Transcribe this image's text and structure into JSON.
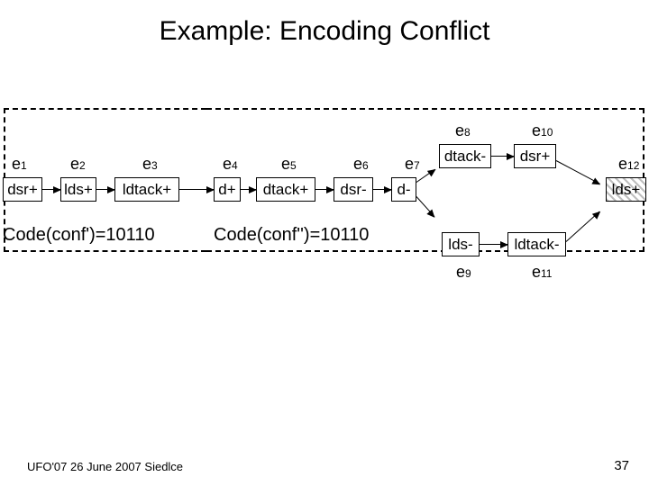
{
  "title": "Example: Encoding Conflict",
  "events": {
    "e1": "e",
    "e2": "e",
    "e3": "e",
    "e4": "e",
    "e5": "e",
    "e6": "e",
    "e7": "e",
    "e8": "e",
    "e9": "e",
    "e10": "e",
    "e11": "e",
    "e12": "e",
    "s1": "1",
    "s2": "2",
    "s3": "3",
    "s4": "4",
    "s5": "5",
    "s6": "6",
    "s7": "7",
    "s8": "8",
    "s9": "9",
    "s10": "10",
    "s11": "11",
    "s12": "12"
  },
  "chart_data": {
    "type": "diagram",
    "nodes": [
      {
        "id": "n1",
        "label": "dsr+",
        "event": "e1"
      },
      {
        "id": "n2",
        "label": "lds+",
        "event": "e2"
      },
      {
        "id": "n3",
        "label": "ldtack+",
        "event": "e3"
      },
      {
        "id": "n4",
        "label": "d+",
        "event": "e4"
      },
      {
        "id": "n5",
        "label": "dtack+",
        "event": "e5"
      },
      {
        "id": "n6",
        "label": "dsr-",
        "event": "e6"
      },
      {
        "id": "n7",
        "label": "d-",
        "event": "e7"
      },
      {
        "id": "n8",
        "label": "dtack-",
        "event": "e8"
      },
      {
        "id": "n9",
        "label": "lds-",
        "event": "e9"
      },
      {
        "id": "n10",
        "label": "dsr+",
        "event": "e10"
      },
      {
        "id": "n11",
        "label": "ldtack-",
        "event": "e11"
      },
      {
        "id": "n12",
        "label": "lds+",
        "event": "e12",
        "highlight": true
      }
    ],
    "edges": [
      [
        "n1",
        "n2"
      ],
      [
        "n2",
        "n3"
      ],
      [
        "n3",
        "n4"
      ],
      [
        "n4",
        "n5"
      ],
      [
        "n5",
        "n6"
      ],
      [
        "n6",
        "n7"
      ],
      [
        "n7",
        "n8"
      ],
      [
        "n8",
        "n10"
      ],
      [
        "n10",
        "n12"
      ],
      [
        "n7",
        "n9"
      ],
      [
        "n9",
        "n11"
      ],
      [
        "n11",
        "n12"
      ],
      [
        "n12",
        "n1"
      ]
    ],
    "regions": [
      {
        "name": "conf'",
        "nodes": [
          "n1",
          "n2",
          "n3"
        ],
        "code": "10110"
      },
      {
        "name": "conf''",
        "nodes": [
          "n4",
          "n5",
          "n6",
          "n7",
          "n8",
          "n9",
          "n10",
          "n11",
          "n12"
        ],
        "code": "10110"
      }
    ]
  },
  "codes": {
    "left_label": "Code(conf')=10110",
    "right_label": "Code(conf'')=10110"
  },
  "footer": "UFO'07 26 June 2007 Siedlce",
  "page": "37"
}
